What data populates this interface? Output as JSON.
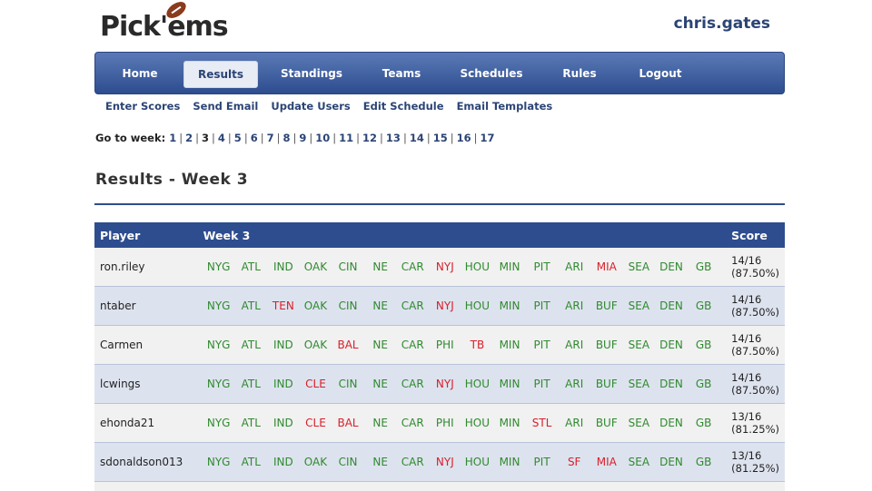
{
  "app": {
    "logo_text": "Pick'ems",
    "username": "chris.gates"
  },
  "nav": {
    "items": [
      "Home",
      "Results",
      "Standings",
      "Teams",
      "Schedules",
      "Rules",
      "Logout"
    ],
    "active": "Results"
  },
  "subnav": [
    "Enter Scores",
    "Send Email",
    "Update Users",
    "Edit Schedule",
    "Email Templates"
  ],
  "weeks": {
    "label": "Go to week:",
    "current": "3",
    "list": [
      "1",
      "2",
      "3",
      "4",
      "5",
      "6",
      "7",
      "8",
      "9",
      "10",
      "11",
      "12",
      "13",
      "14",
      "15",
      "16",
      "17"
    ]
  },
  "page_title": "Results - Week 3",
  "table": {
    "headers": {
      "player": "Player",
      "week": "Week 3",
      "score": "Score"
    },
    "rows": [
      {
        "player": "ron.riley",
        "score_line1": "14/16",
        "score_line2": "(87.50%)",
        "picks": [
          [
            "NYG",
            "c"
          ],
          [
            "ATL",
            "c"
          ],
          [
            "IND",
            "c"
          ],
          [
            "OAK",
            "c"
          ],
          [
            "CIN",
            "c"
          ],
          [
            "NE",
            "c"
          ],
          [
            "CAR",
            "c"
          ],
          [
            "NYJ",
            "w"
          ],
          [
            "HOU",
            "c"
          ],
          [
            "MIN",
            "c"
          ],
          [
            "PIT",
            "c"
          ],
          [
            "ARI",
            "c"
          ],
          [
            "MIA",
            "w"
          ],
          [
            "SEA",
            "c"
          ],
          [
            "DEN",
            "c"
          ],
          [
            "GB",
            "c"
          ]
        ]
      },
      {
        "player": "ntaber",
        "score_line1": "14/16",
        "score_line2": "(87.50%)",
        "picks": [
          [
            "NYG",
            "c"
          ],
          [
            "ATL",
            "c"
          ],
          [
            "TEN",
            "w"
          ],
          [
            "OAK",
            "c"
          ],
          [
            "CIN",
            "c"
          ],
          [
            "NE",
            "c"
          ],
          [
            "CAR",
            "c"
          ],
          [
            "NYJ",
            "w"
          ],
          [
            "HOU",
            "c"
          ],
          [
            "MIN",
            "c"
          ],
          [
            "PIT",
            "c"
          ],
          [
            "ARI",
            "c"
          ],
          [
            "BUF",
            "c"
          ],
          [
            "SEA",
            "c"
          ],
          [
            "DEN",
            "c"
          ],
          [
            "GB",
            "c"
          ]
        ]
      },
      {
        "player": "Carmen",
        "score_line1": "14/16",
        "score_line2": "(87.50%)",
        "picks": [
          [
            "NYG",
            "c"
          ],
          [
            "ATL",
            "c"
          ],
          [
            "IND",
            "c"
          ],
          [
            "OAK",
            "c"
          ],
          [
            "BAL",
            "w"
          ],
          [
            "NE",
            "c"
          ],
          [
            "CAR",
            "c"
          ],
          [
            "PHI",
            "c"
          ],
          [
            "TB",
            "w"
          ],
          [
            "MIN",
            "c"
          ],
          [
            "PIT",
            "c"
          ],
          [
            "ARI",
            "c"
          ],
          [
            "BUF",
            "c"
          ],
          [
            "SEA",
            "c"
          ],
          [
            "DEN",
            "c"
          ],
          [
            "GB",
            "c"
          ]
        ]
      },
      {
        "player": "lcwings",
        "score_line1": "14/16",
        "score_line2": "(87.50%)",
        "picks": [
          [
            "NYG",
            "c"
          ],
          [
            "ATL",
            "c"
          ],
          [
            "IND",
            "c"
          ],
          [
            "CLE",
            "w"
          ],
          [
            "CIN",
            "c"
          ],
          [
            "NE",
            "c"
          ],
          [
            "CAR",
            "c"
          ],
          [
            "NYJ",
            "w"
          ],
          [
            "HOU",
            "c"
          ],
          [
            "MIN",
            "c"
          ],
          [
            "PIT",
            "c"
          ],
          [
            "ARI",
            "c"
          ],
          [
            "BUF",
            "c"
          ],
          [
            "SEA",
            "c"
          ],
          [
            "DEN",
            "c"
          ],
          [
            "GB",
            "c"
          ]
        ]
      },
      {
        "player": "ehonda21",
        "score_line1": "13/16",
        "score_line2": "(81.25%)",
        "picks": [
          [
            "NYG",
            "c"
          ],
          [
            "ATL",
            "c"
          ],
          [
            "IND",
            "c"
          ],
          [
            "CLE",
            "w"
          ],
          [
            "BAL",
            "w"
          ],
          [
            "NE",
            "c"
          ],
          [
            "CAR",
            "c"
          ],
          [
            "PHI",
            "c"
          ],
          [
            "HOU",
            "c"
          ],
          [
            "MIN",
            "c"
          ],
          [
            "STL",
            "w"
          ],
          [
            "ARI",
            "c"
          ],
          [
            "BUF",
            "c"
          ],
          [
            "SEA",
            "c"
          ],
          [
            "DEN",
            "c"
          ],
          [
            "GB",
            "c"
          ]
        ]
      },
      {
        "player": "sdonaldson013",
        "score_line1": "13/16",
        "score_line2": "(81.25%)",
        "picks": [
          [
            "NYG",
            "c"
          ],
          [
            "ATL",
            "c"
          ],
          [
            "IND",
            "c"
          ],
          [
            "OAK",
            "c"
          ],
          [
            "CIN",
            "c"
          ],
          [
            "NE",
            "c"
          ],
          [
            "CAR",
            "c"
          ],
          [
            "NYJ",
            "w"
          ],
          [
            "HOU",
            "c"
          ],
          [
            "MIN",
            "c"
          ],
          [
            "PIT",
            "c"
          ],
          [
            "SF",
            "w"
          ],
          [
            "MIA",
            "w"
          ],
          [
            "SEA",
            "c"
          ],
          [
            "DEN",
            "c"
          ],
          [
            "GB",
            "c"
          ]
        ]
      }
    ]
  }
}
